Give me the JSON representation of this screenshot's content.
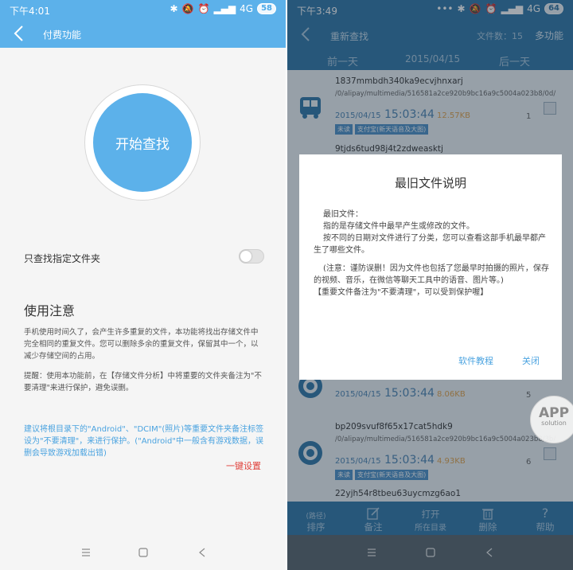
{
  "left": {
    "status": {
      "time": "下午4:01",
      "signal": "4G",
      "battery": "58"
    },
    "header": {
      "title": "付费功能"
    },
    "start_button": "开始查找",
    "option_label": "只查找指定文件夹",
    "notice": {
      "title": "使用注意",
      "text": "手机使用时间久了，会产生许多重复的文件，本功能将找出存储文件中完全相同的重复文件。您可以删除多余的重复文件，保留其中一个，以减少存储空间的占用。",
      "tip": "提醒：使用本功能前，在【存储文件分析】中将重要的文件夹备注为\"不要清理\"来进行保护，避免误删。",
      "blue": "建议将根目录下的\"Android\"、\"DCIM\"(照片)等重要文件夹备注标签设为\"不要清理\"，来进行保护。(\"Android\"中一般含有游戏数据，误删会导致游戏加载出错)",
      "onekey": "一键设置"
    }
  },
  "right": {
    "status": {
      "time": "下午3:49",
      "signal": "4G",
      "battery": "64"
    },
    "header": {
      "title": "重新查找",
      "count": "文件数：15",
      "multi": "多功能"
    },
    "datebar": {
      "prev": "前一天",
      "date": "2015/04/15",
      "next": "后一天"
    },
    "files": [
      {
        "name": "1837mmbdh340ka9ecvjhnxarj",
        "path": "/0/alipay/multimedia/516581a2ce920b9bc16a9c5004a023b8/0d/",
        "date": "2015/04/15",
        "time": "15:03:44",
        "size": "12.57KB",
        "num": "1",
        "badge1": "未读",
        "badge2": "支付宝(新天语音及大图)"
      },
      {
        "name": "9tjds6tud98j4t2zdweasktj"
      },
      {
        "date": "2015/04/15",
        "time": "15:03:44",
        "size": "8.06KB",
        "num": "5"
      },
      {
        "name": "bp209svuf8f65x17cat5hdk9",
        "path": "/0/alipay/multimedia/516581a2ce920b9bc16a9c5004a023b8/3b/",
        "date": "2015/04/15",
        "time": "15:03:44",
        "size": "4.93KB",
        "num": "6",
        "badge1": "未读",
        "badge2": "支付宝(新天语音及大图)"
      },
      {
        "name": "22yjh54r8tbeu63uycmzg6ao1"
      }
    ],
    "dialog": {
      "title": "最旧文件说明",
      "line1": "最旧文件：",
      "line2": "指的是存储文件中最早产生或修改的文件。",
      "line3": "按不同的日期对文件进行了分类，您可以查看这部手机最早都产生了哪些文件。",
      "line4": "(注意：谨防误删！因为文件也包括了您最早时拍摄的照片，保存的视频、音乐，在微信等聊天工具中的语音、图片等。)",
      "line5": "【重要文件备注为\"不要清理\"，可以受到保护喔】",
      "btn_tutorial": "软件教程",
      "btn_close": "关闭"
    },
    "toolbar": [
      {
        "top": "(路径)",
        "label": "排序"
      },
      {
        "label": "备注"
      },
      {
        "top": "打开",
        "label": "所在目录"
      },
      {
        "label": "删除"
      },
      {
        "label": "帮助"
      }
    ],
    "watermark": {
      "line1": "APP",
      "line2": "solution"
    }
  },
  "colors": {
    "left_accent": "#5cb1ea",
    "right_header": "#2d75a8",
    "warning": "#e0403a",
    "link": "#4aa3e0"
  }
}
